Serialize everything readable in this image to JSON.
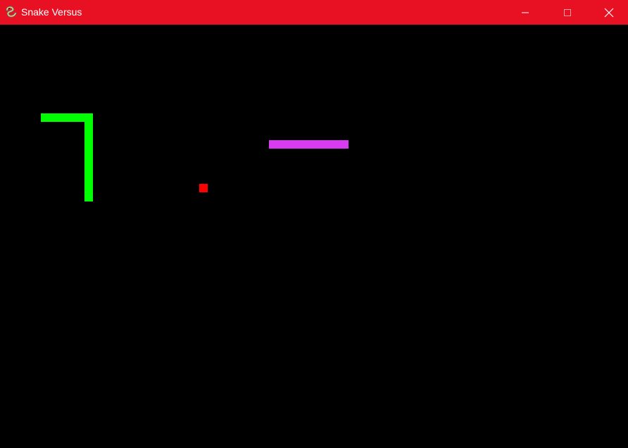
{
  "window": {
    "title": "Snake Versus",
    "controls": {
      "minimize": "minimize-icon",
      "maximize": "maximize-icon",
      "close": "close-icon"
    }
  },
  "colors": {
    "titlebar": "#e81123",
    "background": "#000000",
    "snake1": "#00ff00",
    "snake2": "#d93cf0",
    "food": "#ff0000"
  },
  "snakes": [
    {
      "name": "green-snake",
      "color": "#00ff00"
    },
    {
      "name": "purple-snake",
      "color": "#d93cf0"
    }
  ],
  "food": {
    "color": "#ff0000"
  }
}
